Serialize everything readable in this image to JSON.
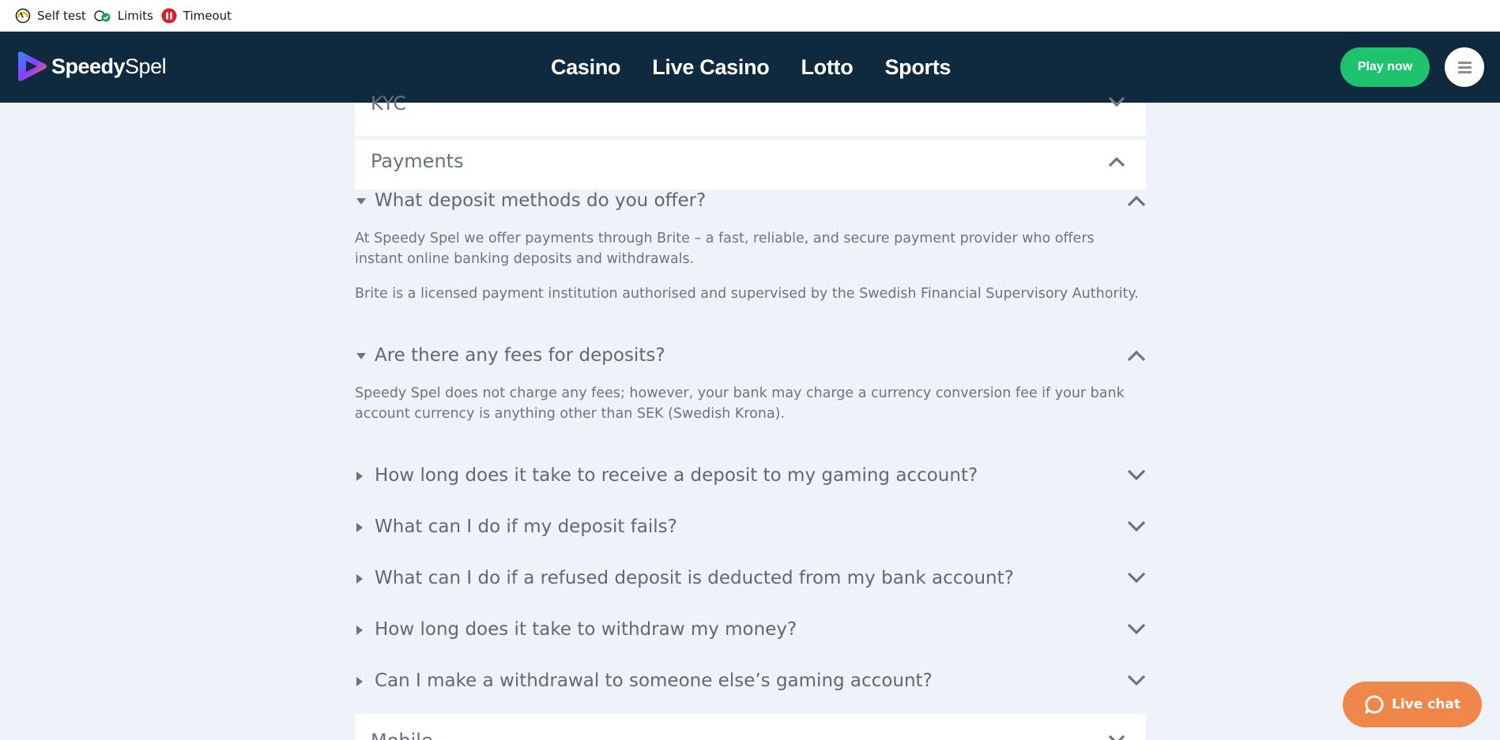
{
  "utility_bar": {
    "self_test": "Self test",
    "limits": "Limits",
    "timeout": "Timeout"
  },
  "header": {
    "logo_bold": "Speedy",
    "logo_light": "Spel",
    "nav": [
      "Casino",
      "Live Casino",
      "Lotto",
      "Sports"
    ],
    "play_now": "Play now"
  },
  "faq": {
    "kyc_title": "KYC",
    "payments_title": "Payments",
    "mobile_title": "Mobile",
    "questions": [
      {
        "q": "What deposit methods do you offer?",
        "expanded": true,
        "answers": [
          "At Speedy Spel we offer payments through Brite – a fast, reliable, and secure payment provider who offers instant online banking deposits and withdrawals.",
          "Brite is a licensed payment institution authorised and supervised by the Swedish Financial Supervisory Authority."
        ]
      },
      {
        "q": "Are there any fees for deposits?",
        "expanded": true,
        "answers": [
          "Speedy Spel does not charge any fees; however, your bank may charge a currency conversion fee if your bank account currency is anything other than SEK (Swedish Krona)."
        ]
      },
      {
        "q": "How long does it take to receive a deposit to my gaming account?",
        "expanded": false
      },
      {
        "q": "What can I do if my deposit fails?",
        "expanded": false
      },
      {
        "q": "What can I do if a refused deposit is deducted from my bank account?",
        "expanded": false
      },
      {
        "q": "How long does it take to withdraw my money?",
        "expanded": false
      },
      {
        "q": "Can I make a withdrawal to someone else’s gaming account?",
        "expanded": false
      }
    ]
  },
  "live_chat": "Live chat",
  "colors": {
    "header_bg": "#0f2a3f",
    "play_green": "#1fc36e",
    "chat_orange": "#f0874a",
    "page_bg": "#eef3fa"
  }
}
